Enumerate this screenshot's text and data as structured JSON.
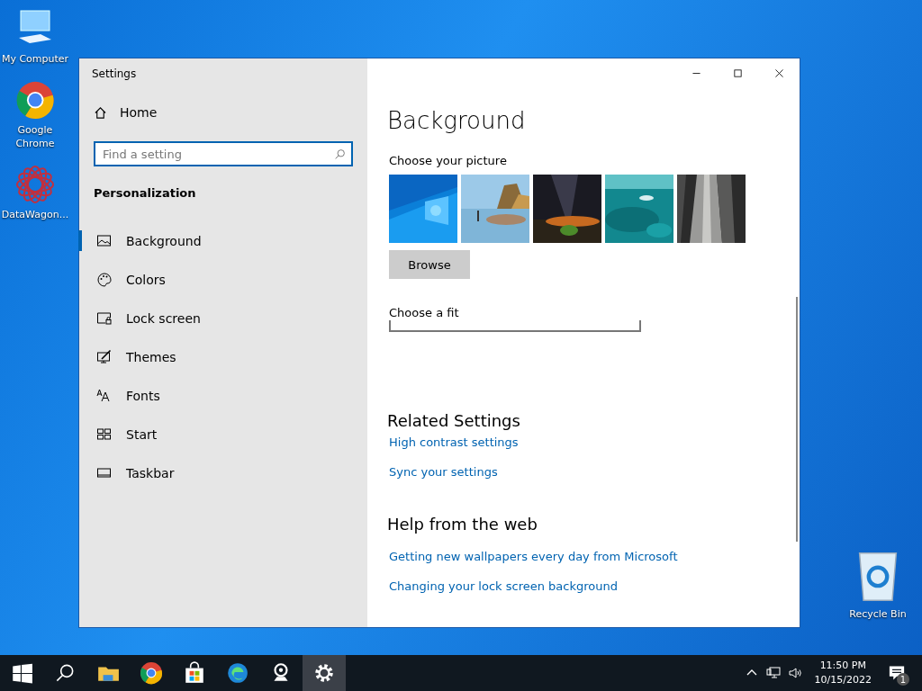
{
  "desktop_icons": [
    {
      "kind": "computer",
      "label": "My Computer"
    },
    {
      "kind": "chrome",
      "label": "Google Chrome"
    },
    {
      "kind": "datawagon",
      "label": "DataWagon..."
    }
  ],
  "recycle_bin": {
    "label": "Recycle Bin"
  },
  "window": {
    "title": "Settings",
    "controls": [
      {
        "kind": "minimize"
      },
      {
        "kind": "maximize"
      },
      {
        "kind": "close"
      }
    ]
  },
  "sidebar": {
    "home": "Home",
    "search": {
      "placeholder": "Find a setting"
    },
    "section": "Personalization",
    "items": [
      {
        "kind": "background",
        "label": "Background",
        "selected": true
      },
      {
        "kind": "colors",
        "label": "Colors",
        "selected": false
      },
      {
        "kind": "lock",
        "label": "Lock screen",
        "selected": false
      },
      {
        "kind": "themes",
        "label": "Themes",
        "selected": false
      },
      {
        "kind": "fonts",
        "label": "Fonts",
        "selected": false
      },
      {
        "kind": "start",
        "label": "Start",
        "selected": false
      },
      {
        "kind": "taskbar",
        "label": "Taskbar",
        "selected": false
      }
    ]
  },
  "content": {
    "heading": "Background",
    "picture_label": "Choose your picture",
    "pictures": [
      {
        "kind": "picture"
      },
      {
        "kind": "picture"
      },
      {
        "kind": "picture"
      },
      {
        "kind": "picture"
      },
      {
        "kind": "picture"
      }
    ],
    "browse": "Browse",
    "fit_label": "Choose a fit",
    "related_heading": "Related Settings",
    "related_links": [
      "High contrast settings",
      "Sync your settings"
    ],
    "help_heading": "Help from the web",
    "help_links": [
      "Getting new wallpapers every day from Microsoft",
      "Changing your lock screen background"
    ]
  },
  "taskbar": {
    "apps": [
      {
        "kind": "start",
        "selected": false
      },
      {
        "kind": "search",
        "selected": false
      },
      {
        "kind": "explorer",
        "selected": false
      },
      {
        "kind": "chrome",
        "selected": false
      },
      {
        "kind": "store",
        "selected": false
      },
      {
        "kind": "edge",
        "selected": false
      },
      {
        "kind": "webcam",
        "selected": false
      },
      {
        "kind": "settings",
        "selected": true
      }
    ],
    "time": "11:50 PM",
    "date": "10/15/2022",
    "notifications": "1"
  }
}
